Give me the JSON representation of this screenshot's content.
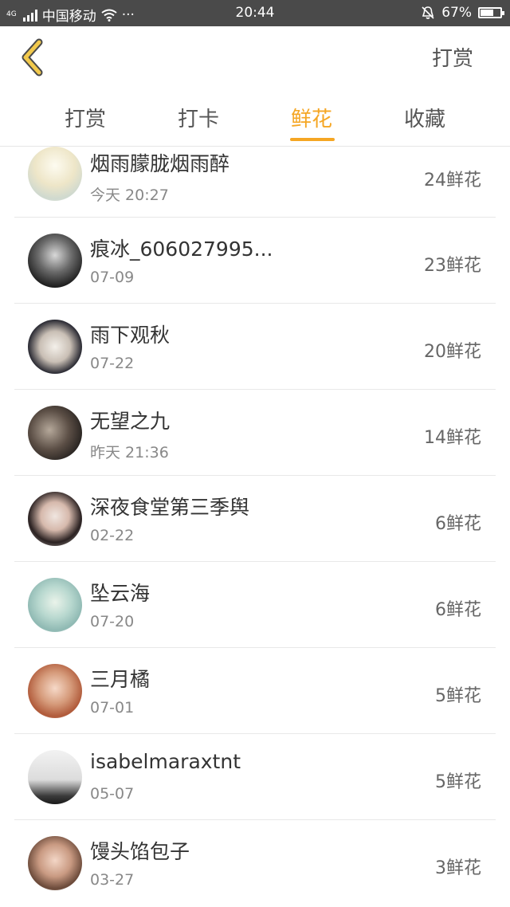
{
  "status_bar": {
    "network_type": "4G",
    "carrier": "中国移动",
    "dots": "···",
    "time": "20:44",
    "battery": "67%",
    "battery_level": 0.67
  },
  "nav": {
    "back_icon": "chevron-left-icon",
    "action_label": "打赏"
  },
  "tabs": [
    {
      "label": "打赏"
    },
    {
      "label": "打卡"
    },
    {
      "label": "鲜花",
      "active": true
    },
    {
      "label": "收藏"
    }
  ],
  "rows": [
    {
      "name": "烟雨朦胧烟雨醉",
      "date": "今天 20:27",
      "count": "24鲜花"
    },
    {
      "name": "痕冰_606027995...",
      "date": "07-09",
      "count": "23鲜花"
    },
    {
      "name": "雨下观秋",
      "date": "07-22",
      "count": "20鲜花"
    },
    {
      "name": "无望之九",
      "date": "昨天 21:36",
      "count": "14鲜花"
    },
    {
      "name": "深夜食堂第三季舆",
      "date": "02-22",
      "count": "6鲜花"
    },
    {
      "name": "坠云海",
      "date": "07-20",
      "count": "6鲜花"
    },
    {
      "name": "三月橘",
      "date": "07-01",
      "count": "5鲜花"
    },
    {
      "name": "isabelmaraxtnt",
      "date": "05-07",
      "count": "5鲜花"
    },
    {
      "name": "馒头馅包子",
      "date": "03-27",
      "count": "3鲜花"
    }
  ],
  "colors": {
    "accent": "#f5a623",
    "back_icon": "#f2c94c"
  }
}
